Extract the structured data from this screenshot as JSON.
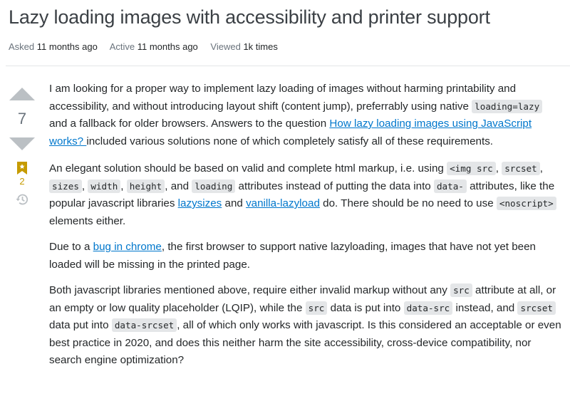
{
  "question": {
    "title": "Lazy loading images with accessibility and printer support",
    "meta": {
      "asked_label": "Asked",
      "asked_value": "11 months ago",
      "active_label": "Active",
      "active_value": "11 months ago",
      "viewed_label": "Viewed",
      "viewed_value": "1k times"
    }
  },
  "votes": {
    "score": "7",
    "upvote_icon": "triangle-up",
    "downvote_icon": "triangle-down",
    "bookmark_icon": "bookmark-star",
    "bookmark_count": "2",
    "history_icon": "history-clock"
  },
  "colors": {
    "link": "#0077cc",
    "bookmark": "#c69b00",
    "vote_arrow": "#bbc0c4",
    "code_bg": "#e4e6e8"
  },
  "body": {
    "p1": {
      "t1": "I am looking for a proper way to implement lazy loading of images without harming printability and accessibility, and without introducing layout shift (content jump), preferrably using native ",
      "c1": "loading=lazy",
      "t2": " and a fallback for older browsers. Answers to the question ",
      "link1": "How lazy loading images using JavaScript works? ",
      "t3": "included various solutions none of which completely satisfy all of these requirements."
    },
    "p2": {
      "t1": "An elegant solution should be based on valid and complete html markup, i.e. using ",
      "c1": "<img src",
      "t2": ", ",
      "c2": "srcset",
      "t3": ", ",
      "c3": "sizes",
      "t4": ", ",
      "c4": "width",
      "t5": ", ",
      "c5": "height",
      "t6": ", and ",
      "c6": "loading",
      "t7": " attributes instead of putting the data into ",
      "c7": "data-",
      "t8": " attributes, like the popular javascript libraries ",
      "link1": "lazysizes",
      "t9": " and ",
      "link2": "vanilla-lazyload",
      "t10": " do. There should be no need to use ",
      "c8": "<noscript>",
      "t11": " elements either."
    },
    "p3": {
      "t1": "Due to a ",
      "link1": "bug in chrome",
      "t2": ", the first browser to support native lazyloading, images that have not yet been loaded will be missing in the printed page."
    },
    "p4": {
      "t1": "Both javascript libraries mentioned above, require either invalid markup without any ",
      "c1": "src",
      "t2": " attribute at all, or an empty or low quality placeholder (LQIP), while the ",
      "c2": "src",
      "t3": " data is put into ",
      "c3": "data-src",
      "t4": " instead, and ",
      "c4": "srcset",
      "t5": " data put into ",
      "c5": "data-srcset",
      "t6": ", all of which only works with javascript. Is this considered an acceptable or even best practice in 2020, and does this neither harm the site accessibility, cross-device compatibility, nor search engine optimization?"
    }
  }
}
